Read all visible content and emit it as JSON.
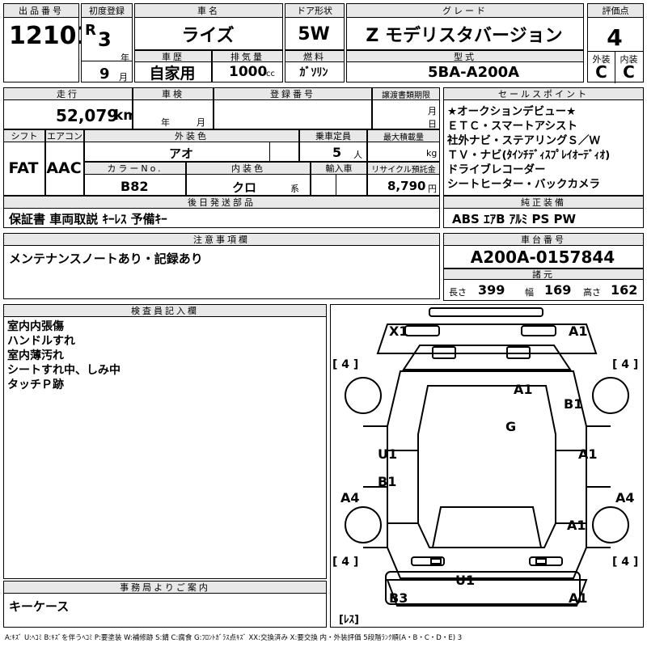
{
  "lot": {
    "label": "出品番号",
    "value": "12101"
  },
  "first_reg": {
    "label": "初度登録",
    "era": "R",
    "year": "3",
    "year_unit": "年",
    "month": "9",
    "month_unit": "月"
  },
  "car_name": {
    "label": "車名",
    "value": "ライズ"
  },
  "door": {
    "label": "ドア形状",
    "value": "5W"
  },
  "grade": {
    "label": "グレード",
    "value": "Z モデリスタバージョン"
  },
  "score": {
    "label": "評価点",
    "value": "4"
  },
  "history": {
    "label": "車歴",
    "value": "自家用"
  },
  "displacement": {
    "label": "排気量",
    "value": "1000",
    "unit": "cc"
  },
  "fuel": {
    "label": "燃料",
    "value": "ｶﾞｿﾘﾝ"
  },
  "model": {
    "label": "型式",
    "value": "5BA-A200A"
  },
  "ext_grade": {
    "label": "外装",
    "value": "C"
  },
  "int_grade": {
    "label": "内装",
    "value": "C"
  },
  "mileage": {
    "label": "走行",
    "value": "52,079",
    "unit": "km"
  },
  "inspection": {
    "label": "車検",
    "year_unit": "年",
    "month_unit": "月"
  },
  "reg_no": {
    "label": "登録番号"
  },
  "transfer": {
    "label": "譲渡書類期限",
    "month_unit": "月",
    "day_unit": "日"
  },
  "shift": {
    "label": "シフト",
    "value": "FAT"
  },
  "ac": {
    "label": "エアコン",
    "value": "AAC"
  },
  "ext_color": {
    "label": "外装色",
    "value": "アオ"
  },
  "capacity": {
    "label": "乗車定員",
    "value": "5",
    "unit": "人"
  },
  "load": {
    "label": "最大積載量",
    "unit": "kg"
  },
  "color_no": {
    "label": "カラーNo.",
    "value": "B82"
  },
  "int_color": {
    "label": "内装色",
    "value": "クロ",
    "unit": "系"
  },
  "import": {
    "label": "輸入車"
  },
  "recycle": {
    "label": "リサイクル預託金",
    "value": "8,790",
    "unit": "円"
  },
  "sales_points": {
    "label": "セールスポイント",
    "items": [
      "★オークションデビュー★",
      "ＥＴＣ・スマートアシスト",
      "社外ナビ・ステアリングＳ／Ｗ",
      "ＴＶ・ナビ(ﾀｲﾝﾁﾃﾞｨｽﾌﾟﾚｲｵｰﾃﾞｨｵ)",
      "ドライブレコーダー",
      "シートヒーター・バックカメラ"
    ]
  },
  "later_parts": {
    "label": "後日発送部品",
    "value": "保証書 車両取説 ｷｰﾚｽ 予備ｷｰ"
  },
  "equipment": {
    "label": "純正装備",
    "value": "ABS ｴｱB ｱﾙﾐ PS PW"
  },
  "notes": {
    "label": "注意事項欄",
    "value": "メンテナンスノートあり・記録あり"
  },
  "chassis": {
    "label": "車台番号",
    "value": "A200A-0157844"
  },
  "specs": {
    "label": "諸元",
    "length_label": "長さ",
    "length": "399",
    "width_label": "幅",
    "width": "169",
    "height_label": "高さ",
    "height": "162"
  },
  "inspector": {
    "label": "検査員記入欄",
    "lines": [
      "室内内張傷",
      "ハンドルすれ",
      "室内薄汚れ",
      "シートすれ中、しみ中",
      "タッチＰ跡"
    ]
  },
  "office": {
    "label": "事務局よりご案内",
    "value": "キーケース"
  },
  "legend": "A:ｷｽﾞ U:ﾍｺﾐ B:ｷｽﾞを伴うﾍｺﾐ P:要塗装 W:補修跡 S:錆 C:腐食 G:ﾌﾛﾝﾄｶﾞﾗｽ点ｷｽﾞ XX:交換済み X:要交換 内・外装評価 5段階ﾗﾝｸ順(A・B・C・D・E) 3",
  "diagram": {
    "marks": {
      "front_left": "X1",
      "front_right": "A1",
      "hood": "A1",
      "fender_right": "B1",
      "windshield": "G",
      "door_left": "U1",
      "door_right": "A1",
      "rear_door_left": "B1",
      "rear_fender_right": "A1",
      "rear_left": "B3",
      "rear_right": "A1",
      "rear_bumper": "U1",
      "step_left": "A4",
      "step_right": "A4"
    },
    "tires": {
      "fl": "[ 4 ]",
      "fr": "[ 4 ]",
      "rl": "[ 4 ]",
      "rr": "[ 4 ]"
    },
    "spare": "[ﾚｽ]"
  }
}
